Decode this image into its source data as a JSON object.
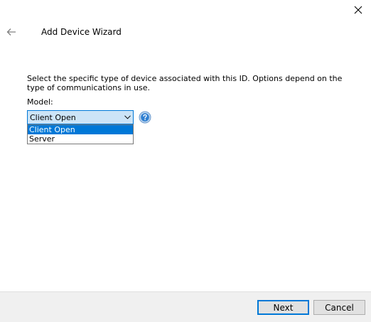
{
  "window": {
    "title": "Add Device Wizard"
  },
  "icons": {
    "back": "arrow-left-icon",
    "close": "close-icon",
    "help": "question-circle-icon",
    "dropdown": "chevron-down-icon"
  },
  "content": {
    "instructions": "Select the specific type of device associated with this ID. Options depend on the type of communications in use.",
    "model_label": "Model:",
    "model_value": "Client Open",
    "model_options": [
      "Client Open",
      "Server"
    ],
    "selected_option_index": 0
  },
  "footer": {
    "next_label": "Next",
    "cancel_label": "Cancel"
  },
  "colors": {
    "accent": "#0078d7",
    "combo_background": "#cce4f7",
    "footer_background": "#f0f0f0",
    "help_icon": "#2f7fd1"
  }
}
